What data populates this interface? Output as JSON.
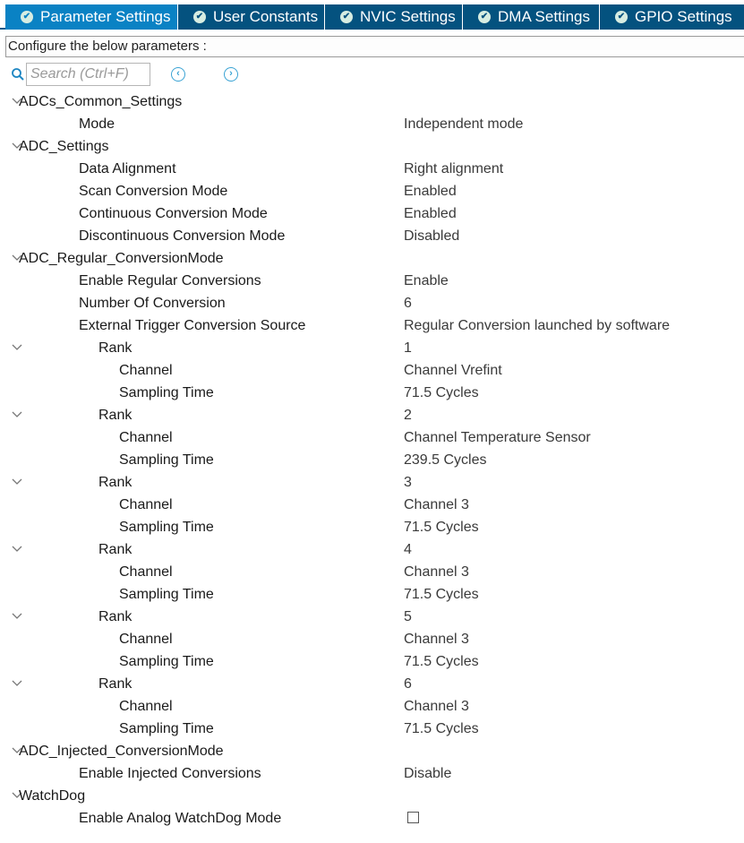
{
  "tabs": [
    {
      "label": "Parameter Settings",
      "active": true
    },
    {
      "label": "User Constants",
      "active": false
    },
    {
      "label": "NVIC Settings",
      "active": false
    },
    {
      "label": "DMA Settings",
      "active": false
    },
    {
      "label": "GPIO Settings",
      "active": false
    }
  ],
  "caption": "Configure the below parameters :",
  "search": {
    "placeholder": "Search (Ctrl+F)",
    "prev_glyph": "‹",
    "next_glyph": "›"
  },
  "check_glyph": "✔",
  "tree": [
    {
      "label": "ADCs_Common_Settings",
      "value": "",
      "level": 0,
      "chevron": true
    },
    {
      "label": "Mode",
      "value": "Independent mode",
      "level": 1
    },
    {
      "label": "ADC_Settings",
      "value": "",
      "level": 0,
      "chevron": true
    },
    {
      "label": "Data Alignment",
      "value": "Right alignment",
      "level": 1
    },
    {
      "label": "Scan Conversion Mode",
      "value": "Enabled",
      "level": 1
    },
    {
      "label": "Continuous Conversion Mode",
      "value": "Enabled",
      "level": 1
    },
    {
      "label": "Discontinuous Conversion Mode",
      "value": "Disabled",
      "level": 1
    },
    {
      "label": "ADC_Regular_ConversionMode",
      "value": "",
      "level": 0,
      "chevron": true
    },
    {
      "label": "Enable Regular Conversions",
      "value": "Enable",
      "level": 1
    },
    {
      "label": "Number Of Conversion",
      "value": "6",
      "level": 1
    },
    {
      "label": "External Trigger Conversion Source",
      "value": "Regular Conversion launched by software",
      "level": 1
    },
    {
      "label": "Rank",
      "value": "1",
      "level": 2,
      "chevron": true
    },
    {
      "label": "Channel",
      "value": "Channel Vrefint",
      "level": 3
    },
    {
      "label": "Sampling Time",
      "value": "71.5 Cycles",
      "level": 3
    },
    {
      "label": "Rank",
      "value": "2",
      "level": 2,
      "chevron": true
    },
    {
      "label": "Channel",
      "value": "Channel Temperature Sensor",
      "level": 3
    },
    {
      "label": "Sampling Time",
      "value": "239.5 Cycles",
      "level": 3
    },
    {
      "label": "Rank",
      "value": "3",
      "level": 2,
      "chevron": true
    },
    {
      "label": "Channel",
      "value": "Channel 3",
      "level": 3
    },
    {
      "label": "Sampling Time",
      "value": "71.5 Cycles",
      "level": 3
    },
    {
      "label": "Rank",
      "value": "4",
      "level": 2,
      "chevron": true
    },
    {
      "label": "Channel",
      "value": "Channel 3",
      "level": 3
    },
    {
      "label": "Sampling Time",
      "value": "71.5 Cycles",
      "level": 3
    },
    {
      "label": "Rank",
      "value": "5",
      "level": 2,
      "chevron": true
    },
    {
      "label": "Channel",
      "value": "Channel 3",
      "level": 3
    },
    {
      "label": "Sampling Time",
      "value": "71.5 Cycles",
      "level": 3
    },
    {
      "label": "Rank",
      "value": "6",
      "level": 2,
      "chevron": true
    },
    {
      "label": "Channel",
      "value": "Channel 3",
      "level": 3
    },
    {
      "label": "Sampling Time",
      "value": "71.5 Cycles",
      "level": 3
    },
    {
      "label": "ADC_Injected_ConversionMode",
      "value": "",
      "level": 0,
      "chevron": true
    },
    {
      "label": "Enable Injected Conversions",
      "value": "Disable",
      "level": 1
    },
    {
      "label": "WatchDog",
      "value": "",
      "level": 0,
      "chevron": true
    },
    {
      "label": "Enable Analog WatchDog Mode",
      "value": "",
      "level": 1,
      "checkbox": true,
      "checked": false
    }
  ]
}
